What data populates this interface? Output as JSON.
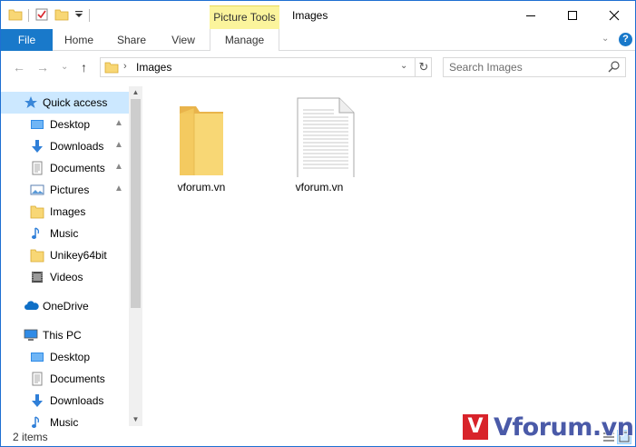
{
  "window": {
    "title": "Images"
  },
  "ribbon": {
    "context_label": "Picture Tools",
    "tabs": [
      "File",
      "Home",
      "Share",
      "View",
      "Manage"
    ],
    "help": "?"
  },
  "address": {
    "crumb": "Images"
  },
  "search": {
    "placeholder": "Search Images"
  },
  "sidebar": {
    "quick_access": "Quick access",
    "quick_items": [
      "Desktop",
      "Downloads",
      "Documents",
      "Pictures",
      "Images",
      "Music",
      "Unikey64bit",
      "Videos"
    ],
    "onedrive": "OneDrive",
    "this_pc": "This PC",
    "pc_items": [
      "Desktop",
      "Documents",
      "Downloads",
      "Music"
    ]
  },
  "files": [
    {
      "name": "vforum.vn",
      "type": "folder"
    },
    {
      "name": "vforum.vn",
      "type": "document"
    }
  ],
  "status": {
    "count": "2 items"
  },
  "watermark": {
    "logo": "V",
    "text": "Vforum.vn"
  },
  "colors": {
    "accent": "#1979ca",
    "context_tab": "#fbf49c",
    "selected": "#cce8ff",
    "folder": "#f8d775"
  }
}
